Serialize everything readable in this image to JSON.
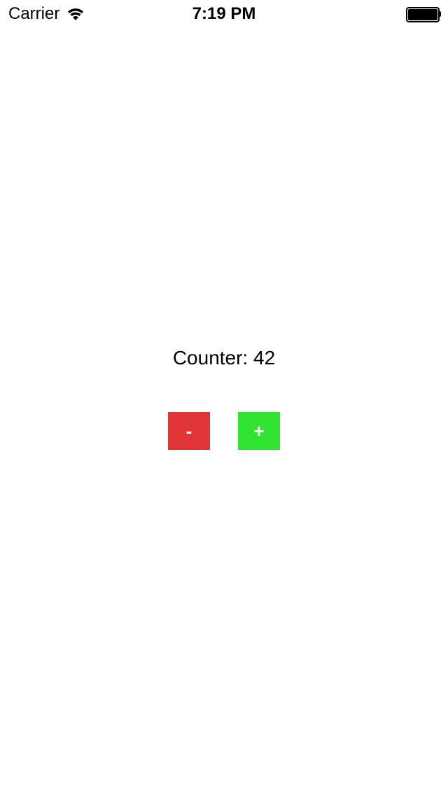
{
  "status_bar": {
    "carrier": "Carrier",
    "time": "7:19 PM",
    "icons": [
      "wifi-icon",
      "battery-icon"
    ]
  },
  "counter": {
    "label": "Counter: 42",
    "value": 42
  },
  "buttons": {
    "decrement_label": "-",
    "decrement_color": "#e03538",
    "increment_label": "+",
    "increment_color": "#33e333"
  },
  "colors": {
    "background": "#ffffff",
    "text": "#000000"
  }
}
